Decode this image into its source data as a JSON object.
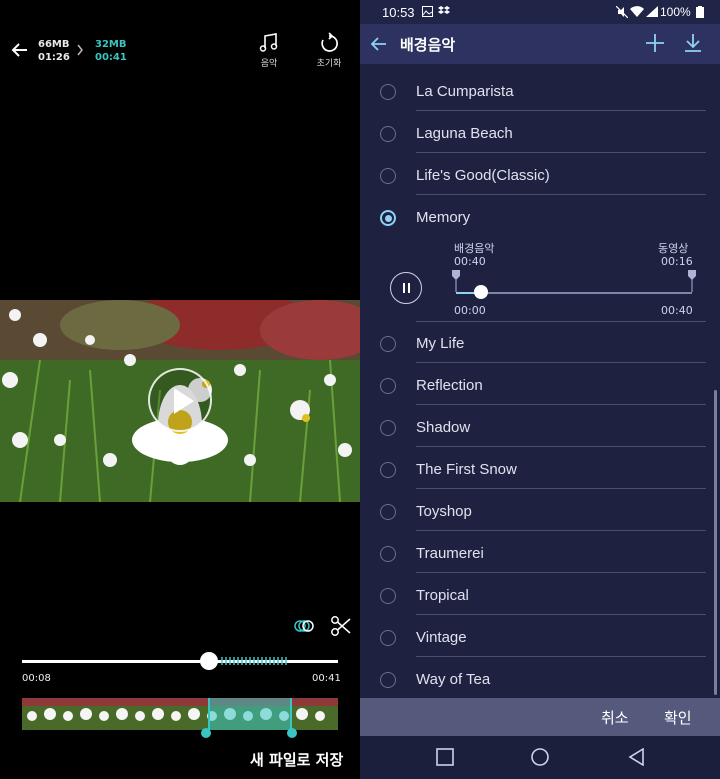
{
  "editor": {
    "original_size": "66MB",
    "original_duration": "01:26",
    "new_size": "32MB",
    "new_duration": "00:41",
    "music_tool_label": "음악",
    "reset_tool_label": "초기화",
    "trim_start": "00:08",
    "trim_end": "00:41",
    "save_new_file_label": "새 파일로 저장",
    "accent_color": "#39c6c3"
  },
  "status_bar": {
    "time": "10:53",
    "battery": "100%"
  },
  "music_picker": {
    "title": "배경음악",
    "songs": [
      {
        "name": "La Cumparista",
        "selected": false
      },
      {
        "name": "Laguna Beach",
        "selected": false
      },
      {
        "name": "Life's Good(Classic)",
        "selected": false
      },
      {
        "name": "Memory",
        "selected": true
      },
      {
        "name": "My Life",
        "selected": false
      },
      {
        "name": "Reflection",
        "selected": false
      },
      {
        "name": "Shadow",
        "selected": false
      },
      {
        "name": "The First Snow",
        "selected": false
      },
      {
        "name": "Toyshop",
        "selected": false
      },
      {
        "name": "Traumerei",
        "selected": false
      },
      {
        "name": "Tropical",
        "selected": false
      },
      {
        "name": "Vintage",
        "selected": false
      },
      {
        "name": "Way of Tea",
        "selected": false
      }
    ],
    "expanded": {
      "bgm_label": "배경음악",
      "bgm_duration": "00:40",
      "video_label": "동영상",
      "video_duration": "00:16",
      "range_start": "00:00",
      "range_end": "00:40"
    },
    "cancel_label": "취소",
    "confirm_label": "확인",
    "accent_color": "#8fd2f4"
  }
}
